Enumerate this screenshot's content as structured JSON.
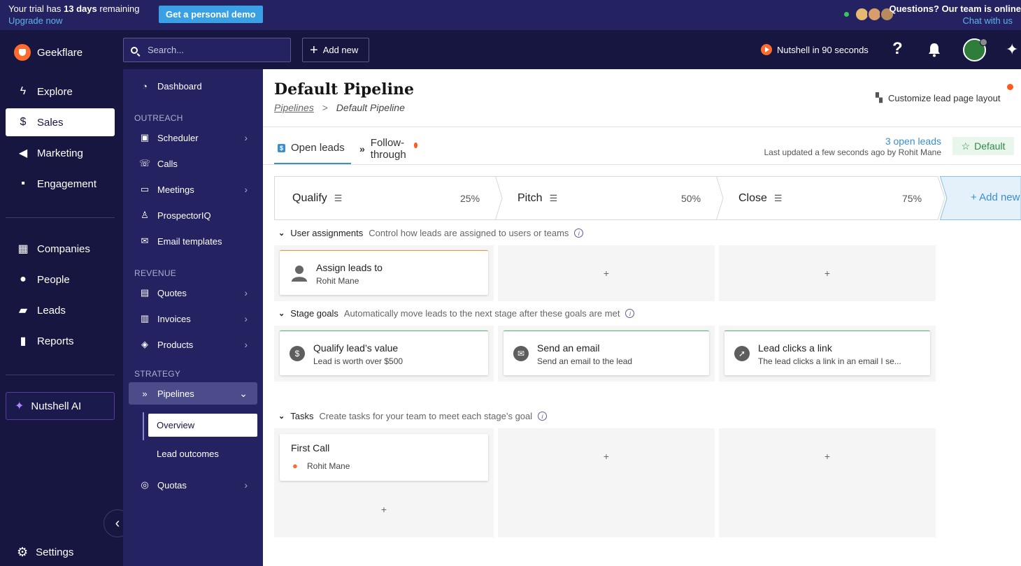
{
  "banner": {
    "trial_pre": "Your trial has",
    "trial_days": "13 days",
    "trial_post": "remaining",
    "upgrade": "Upgrade now",
    "demo_button": "Get a personal demo",
    "questions": "Questions? Our team is online",
    "chat": "Chat with us"
  },
  "header": {
    "brand": "Geekflare",
    "search_placeholder": "Search...",
    "add_new": "Add new",
    "video": "Nutshell in 90 seconds",
    "help": "?"
  },
  "nav": {
    "items": [
      {
        "label": "Explore",
        "icon": "lightning-icon"
      },
      {
        "label": "Sales",
        "icon": "dollar-icon"
      },
      {
        "label": "Marketing",
        "icon": "megaphone-icon"
      },
      {
        "label": "Engagement",
        "icon": "chat-icon"
      },
      {
        "label": "Companies",
        "icon": "building-icon"
      },
      {
        "label": "People",
        "icon": "person-icon"
      },
      {
        "label": "Leads",
        "icon": "ticket-icon"
      },
      {
        "label": "Reports",
        "icon": "bar-chart-icon"
      }
    ],
    "ai": "Nutshell AI",
    "settings": "Settings"
  },
  "subnav": {
    "dashboard": "Dashboard",
    "outreach": "OUTREACH",
    "scheduler": "Scheduler",
    "calls": "Calls",
    "meetings": "Meetings",
    "prospector": "ProspectorIQ",
    "email_templates": "Email templates",
    "revenue": "REVENUE",
    "quotes": "Quotes",
    "invoices": "Invoices",
    "products": "Products",
    "strategy": "STRATEGY",
    "pipelines": "Pipelines",
    "overview": "Overview",
    "lead_outcomes": "Lead outcomes",
    "quotas": "Quotas"
  },
  "page": {
    "title": "Default Pipeline",
    "crumb_link": "Pipelines",
    "crumb_sep": ">",
    "crumb_current": "Default Pipeline",
    "customize": "Customize lead page layout",
    "tab_open": "Open leads",
    "tab_follow": "Follow-through",
    "open_leads": "3 open leads",
    "updated": "Last updated a few seconds ago by Rohit Mane",
    "default_badge": "Default"
  },
  "stages": [
    {
      "name": "Qualify",
      "pct": "25%"
    },
    {
      "name": "Pitch",
      "pct": "50%"
    },
    {
      "name": "Close",
      "pct": "75%"
    }
  ],
  "add_stage": "+ Add new",
  "sections": {
    "assign_title": "User assignments",
    "assign_desc": "Control how leads are assigned to users or teams",
    "goals_title": "Stage goals",
    "goals_desc": "Automatically move leads to the next stage after these goals are met",
    "tasks_title": "Tasks",
    "tasks_desc": "Create tasks for your team to meet each stage’s goal"
  },
  "assign_card": {
    "title": "Assign leads to",
    "sub": "Rohit Mane"
  },
  "goals": [
    {
      "title": "Qualify lead’s value",
      "sub": "Lead is worth over $500",
      "icon": "dollar-icon"
    },
    {
      "title": "Send an email",
      "sub": "Send an email to the lead",
      "icon": "envelope-icon"
    },
    {
      "title": "Lead clicks a link",
      "sub": "The lead clicks a link in an email I se...",
      "icon": "cursor-click-icon"
    }
  ],
  "task_card": {
    "title": "First Call",
    "sub": "Rohit Mane"
  },
  "plus": "+",
  "colors": {
    "accent": "#3b8fcc",
    "brand_orange": "#ff6b2c",
    "nav_bg": "#161640",
    "subnav_bg": "#242260"
  }
}
